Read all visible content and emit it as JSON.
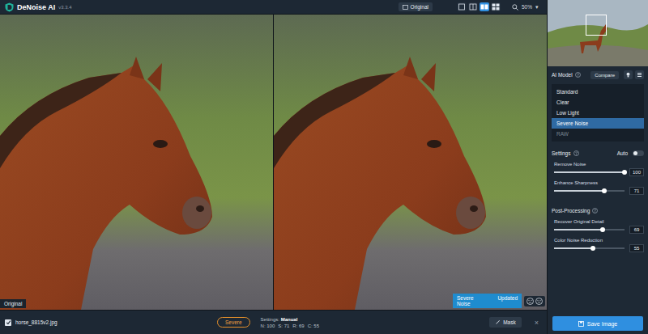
{
  "app": {
    "title": "DeNoise AI",
    "version": "v3.3.4"
  },
  "toolbar": {
    "original_button": "Original",
    "view_modes": [
      {
        "selected": false
      },
      {
        "selected": false
      },
      {
        "selected": true
      },
      {
        "selected": false
      }
    ],
    "zoom": "50%",
    "zoom_arrow": "▾"
  },
  "preview": {
    "left_label": "Original",
    "model_badge": "Severe Noise",
    "status": "Updated"
  },
  "file_bar": {
    "checked": true,
    "filename": "horse_8815v2.jpg",
    "model": "Severe",
    "settings_label": "Settings:",
    "settings_value": "Manual",
    "values": [
      "N: 100",
      "S: 71",
      "R: 69",
      "C: 55"
    ],
    "mask": "Mask",
    "close": "×"
  },
  "panel": {
    "ai_model": {
      "label": "AI Model",
      "compare": "Compare",
      "models": [
        {
          "label": "Standard",
          "selected": false,
          "disabled": false
        },
        {
          "label": "Clear",
          "selected": false,
          "disabled": false
        },
        {
          "label": "Low Light",
          "selected": false,
          "disabled": false
        },
        {
          "label": "Severe Noise",
          "selected": true,
          "disabled": false
        },
        {
          "label": "RAW",
          "selected": false,
          "disabled": true
        }
      ]
    },
    "settings": {
      "label": "Settings",
      "auto_label": "Auto",
      "auto": false,
      "sliders": [
        {
          "label": "Remove Noise",
          "level": 1.0,
          "value": "100"
        },
        {
          "label": "Enhance Sharpness",
          "level": 0.71,
          "value": "71"
        }
      ]
    },
    "post": {
      "label": "Post-Processing",
      "sliders": [
        {
          "label": "Recover Original Detail",
          "level": 0.69,
          "value": "69"
        },
        {
          "label": "Color Noise Reduction",
          "level": 0.55,
          "value": "55"
        }
      ]
    },
    "save": "Save Image"
  }
}
